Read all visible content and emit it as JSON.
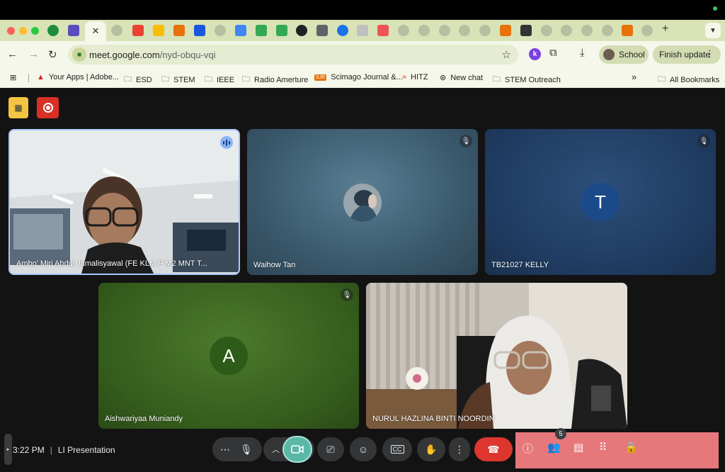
{
  "browser": {
    "url_host": "meet.google.com",
    "url_path": "/nyd-obqu-vqi",
    "profile_label": "School",
    "finish_update_label": "Finish update",
    "extension_letter": "k",
    "new_tab_label": "+"
  },
  "bookmarks": [
    {
      "label": "Your Apps | Adobe...",
      "icon": "adobe-icon"
    },
    {
      "label": "ESD",
      "icon": "folder-icon"
    },
    {
      "label": "STEM",
      "icon": "folder-icon"
    },
    {
      "label": "IEEE",
      "icon": "folder-icon"
    },
    {
      "label": "Radio Amerture",
      "icon": "folder-icon"
    },
    {
      "label": "Scimago Journal &...",
      "icon": "scimago-icon",
      "icon_text": "SJR"
    },
    {
      "label": "HITZ",
      "icon": "hitz-icon"
    },
    {
      "label": "New chat",
      "icon": "chat-icon"
    },
    {
      "label": "STEM Outreach",
      "icon": "folder-icon"
    },
    {
      "label": "All Bookmarks",
      "icon": "folder-icon"
    }
  ],
  "bookmarks_overflow": "»",
  "participants": [
    {
      "name": "Ambo' Miri Abdul Jamalisyawal (FE KLM P M2 MNT T...",
      "speaking": true
    },
    {
      "name": "Waihow Tan",
      "muted": true
    },
    {
      "name": "TB21027 KELLY",
      "initial": "T",
      "muted": true,
      "avatar_color": "#1a4a8a"
    },
    {
      "name": "Aishwariyaa Muniandy",
      "initial": "A",
      "muted": true,
      "avatar_color": "#2e5a1a"
    },
    {
      "name": "NURUL HAZLINA BINTI NOORDIN"
    }
  ],
  "meeting": {
    "time": "3:22 PM",
    "title": "LI Presentation",
    "participant_count": "5"
  },
  "colors": {
    "hangup": "#dc362e",
    "camera_active": "#5bb8a6",
    "chrome_frame": "#d9e3b8",
    "record": "#d93025"
  }
}
